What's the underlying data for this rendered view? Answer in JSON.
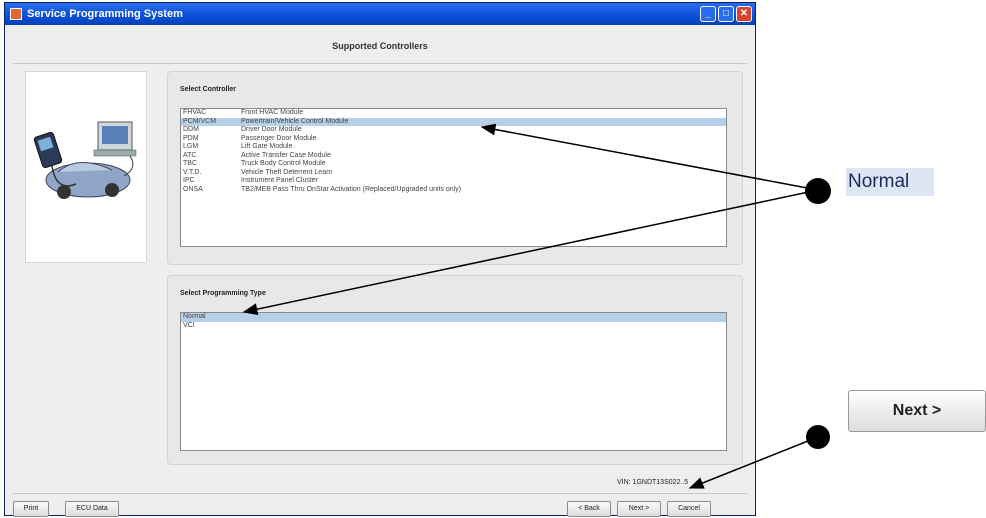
{
  "window": {
    "title": "Service Programming System"
  },
  "heading": "Supported Controllers",
  "controller_group": {
    "label": "Select Controller",
    "items": [
      {
        "code": "FHVAC",
        "desc": "Front HVAC Module"
      },
      {
        "code": "PCM/VCM",
        "desc": "Powertrain/Vehicle Control Module",
        "selected": true
      },
      {
        "code": "DDM",
        "desc": "Driver Door Module"
      },
      {
        "code": "PDM",
        "desc": "Passenger Door Module"
      },
      {
        "code": "LGM",
        "desc": "Lift Gate Module"
      },
      {
        "code": "ATC",
        "desc": "Active Transfer Case Module"
      },
      {
        "code": "TBC",
        "desc": "Truck Body Control Module"
      },
      {
        "code": "V.T.D.",
        "desc": "Vehicle Theft Deterrent Learn"
      },
      {
        "code": "IPC",
        "desc": "Instrument Panel Cluster"
      },
      {
        "code": "ONSA",
        "desc": "TB2/MEB Pass Thru OnStar Activation (Replaced/Upgraded units only)"
      }
    ]
  },
  "programming_group": {
    "label": "Select Programming Type",
    "items": [
      {
        "label": "Normal",
        "selected": true
      },
      {
        "label": "VCI"
      }
    ]
  },
  "vin": "VIN: 1GNDT13S022..5",
  "buttons": {
    "print": "Print",
    "ecu_data": "ECU Data",
    "back": "< Back",
    "next": "Next >",
    "cancel": "Cancel"
  },
  "callouts": {
    "normal": "Normal",
    "next": "Next >"
  }
}
